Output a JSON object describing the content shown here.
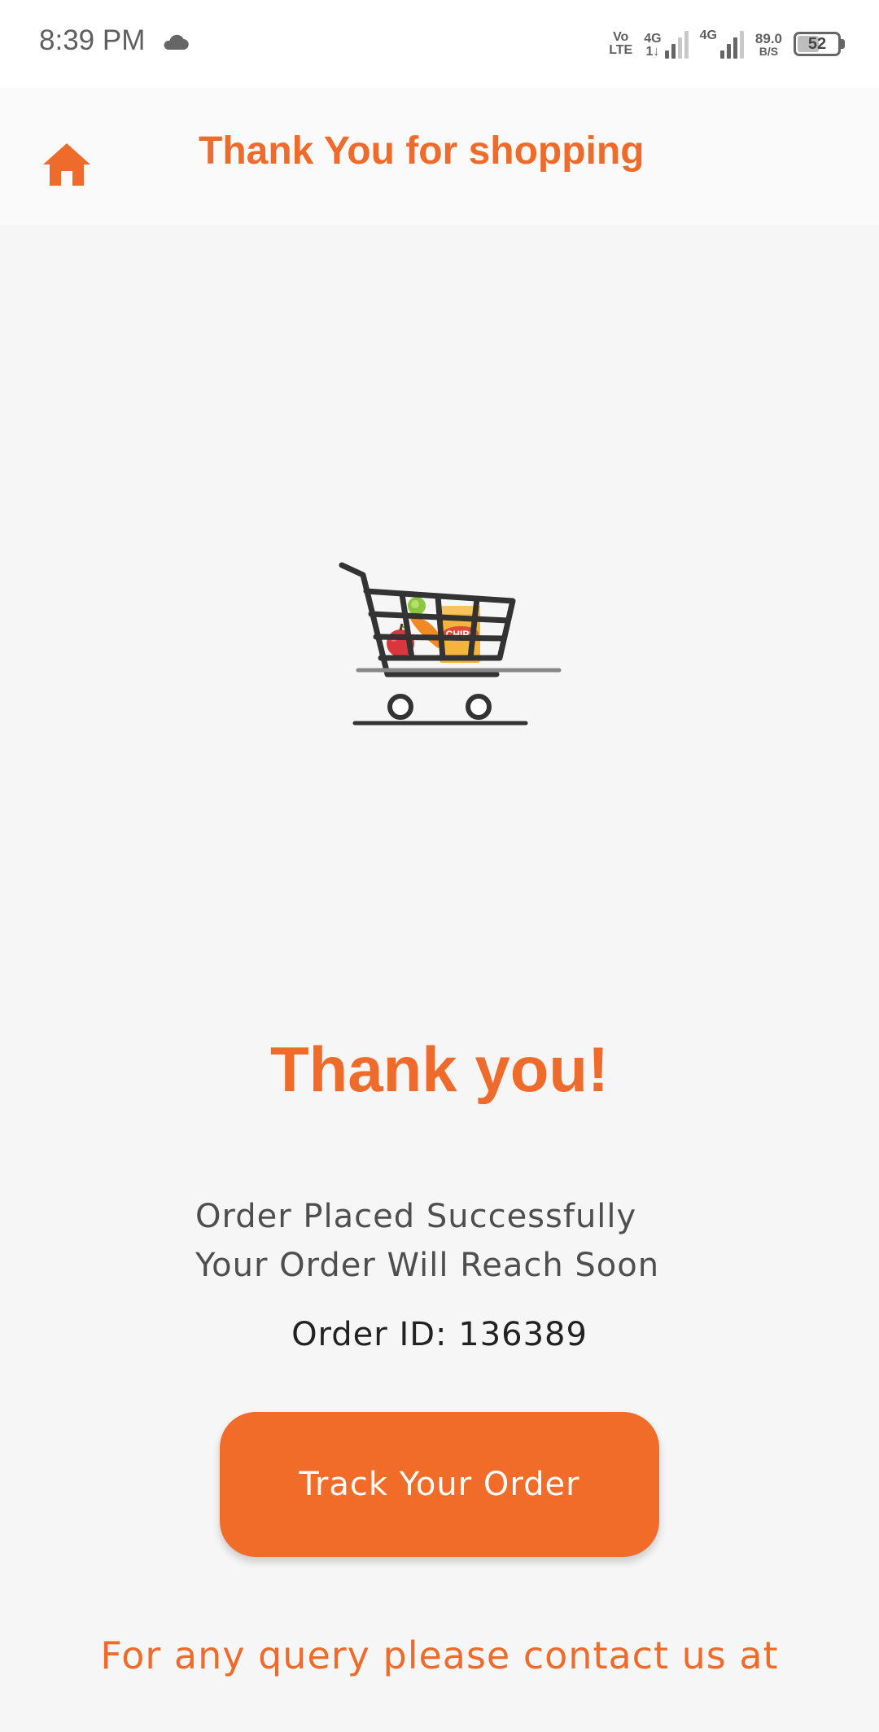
{
  "status_bar": {
    "time": "8:39 PM",
    "volte_top": "Vo",
    "volte_bottom": "LTE",
    "net1": "4G",
    "net1_sub": "1↓",
    "net2": "4G",
    "speed_value": "89.0",
    "speed_unit": "B/S",
    "battery": "52",
    "icons": [
      "cloud-icon",
      "volte-icon",
      "signal-icon",
      "signal-icon",
      "battery-icon"
    ]
  },
  "app_bar": {
    "title": "Thank You for shopping",
    "home_icon": "home-icon"
  },
  "main": {
    "heading": "Thank you!",
    "message_line1": "Order Placed Successfully",
    "message_line2": "Your Order Will Reach Soon",
    "order_id": "Order ID: 136389",
    "track_button": "Track Your Order",
    "contact": "For any query please contact us at",
    "illustration": "shopping-cart-icon",
    "chips_label": "CHIPS"
  },
  "colors": {
    "accent": "#ef6b2b",
    "button": "#f16b29",
    "background": "#f6f6f6"
  }
}
